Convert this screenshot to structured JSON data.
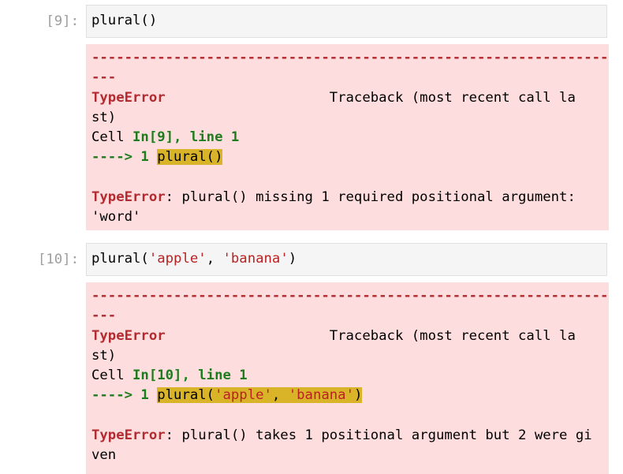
{
  "cells": [
    {
      "prompt": "[9]:",
      "code": [
        {
          "text": "plural()",
          "kind": "plain"
        }
      ],
      "error": {
        "dashes_1": "-------------------------------------------------------------------",
        "dashes_2": "---",
        "error_name": "TypeError",
        "traceback_1": "                    Traceback (most recent call la",
        "traceback_2": "st)",
        "cell_prefix": "Cell ",
        "cell_ref": "In[9], line 1",
        "arrow": "----> 1 ",
        "highlighted": [
          {
            "text": "plural()",
            "kind": "plain"
          }
        ],
        "message_name": "TypeError",
        "message_1": ": plural() missing 1 required positional argument:",
        "message_2": "'word'"
      }
    },
    {
      "prompt": "[10]:",
      "code": [
        {
          "text": "plural(",
          "kind": "plain"
        },
        {
          "text": "'apple'",
          "kind": "string"
        },
        {
          "text": ", ",
          "kind": "plain"
        },
        {
          "text": "'banana'",
          "kind": "string"
        },
        {
          "text": ")",
          "kind": "plain"
        }
      ],
      "error": {
        "dashes_1": "-------------------------------------------------------------------",
        "dashes_2": "---",
        "error_name": "TypeError",
        "traceback_1": "                    Traceback (most recent call la",
        "traceback_2": "st)",
        "cell_prefix": "Cell ",
        "cell_ref": "In[10], line 1",
        "arrow": "----> 1 ",
        "highlighted": [
          {
            "text": "plural(",
            "kind": "plain"
          },
          {
            "text": "'apple'",
            "kind": "string"
          },
          {
            "text": ", ",
            "kind": "plain"
          },
          {
            "text": "'banana'",
            "kind": "string"
          },
          {
            "text": ")",
            "kind": "plain"
          }
        ],
        "message_name": "TypeError",
        "message_1": ": plural() takes 1 positional argument but 2 were gi",
        "message_2": "ven"
      }
    }
  ],
  "colors": {
    "input_bg": "#f5f5f5",
    "output_error_bg": "#fddddd",
    "error_name": "#b22b31",
    "cell_ref": "#1d7c1d",
    "string": "#ba2121",
    "highlight": "#d9b328",
    "prompt": "#9e9e9e"
  }
}
